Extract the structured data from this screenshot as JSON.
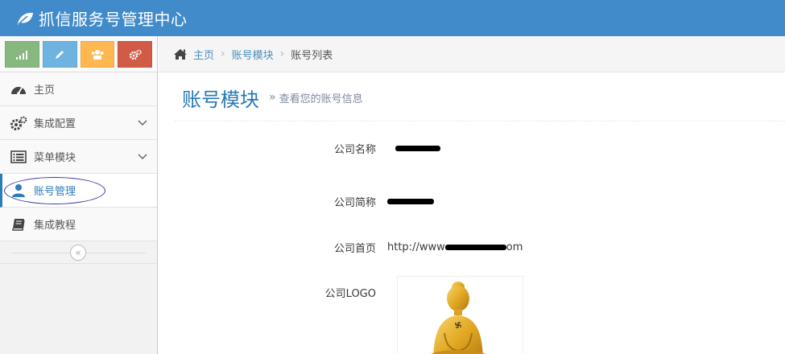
{
  "header": {
    "brand": "抓信服务号管理中心"
  },
  "sidebar": {
    "shortcuts": [
      {
        "icon": "signal-icon",
        "color": "#87b87f"
      },
      {
        "icon": "pencil-icon",
        "color": "#6fb3e0"
      },
      {
        "icon": "users-icon",
        "color": "#ffb752"
      },
      {
        "icon": "cogs-icon",
        "color": "#d15b47"
      }
    ],
    "items": [
      {
        "label": "主页",
        "icon": "dashboard-icon"
      },
      {
        "label": "集成配置",
        "icon": "cogs-icon"
      },
      {
        "label": "菜单模块",
        "icon": "list-icon"
      },
      {
        "label": "账号管理",
        "icon": "user-icon"
      },
      {
        "label": "集成教程",
        "icon": "book-icon"
      }
    ],
    "collapse_glyph": "«"
  },
  "breadcrumbs": {
    "home": "主页",
    "module": "账号模块",
    "current": "账号列表"
  },
  "page": {
    "title": "账号模块",
    "subtitle": "查看您的账号信息",
    "subtitle_prefix": "»"
  },
  "form": {
    "company_name": {
      "label": "公司名称",
      "value": ""
    },
    "company_short": {
      "label": "公司简称",
      "value": ""
    },
    "homepage": {
      "label": "公司首页",
      "prefix": "http://www",
      "suffix": "om"
    },
    "logo": {
      "label": "公司LOGO"
    }
  },
  "colors": {
    "header_bg": "#428bca",
    "accent": "#2679b5"
  }
}
